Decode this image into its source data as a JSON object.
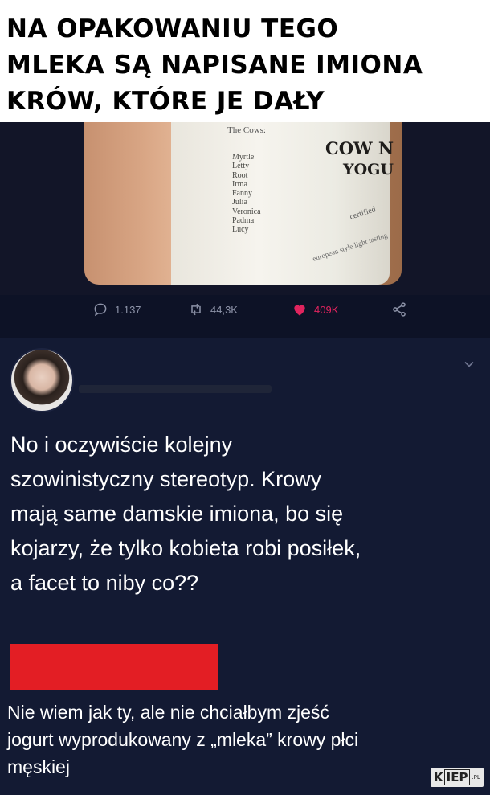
{
  "caption": {
    "lines": [
      "NA OPAKOWANIU TEGO",
      "MLEKA SĄ NAPISANE IMIONA",
      "KRÓW, KTÓRE JE DAŁY"
    ]
  },
  "photo": {
    "cows_heading": "The Cows:",
    "cow_names": [
      "Myrtle",
      "Letty",
      "Root",
      "Irma",
      "Fanny",
      "Julia",
      "Veronica",
      "Padma",
      "Lucy"
    ],
    "brand_line1": "COW N",
    "brand_line2": "YOGU",
    "small_text1": "certified",
    "small_text2": "european style light tasting"
  },
  "tweet_actions": {
    "replies": "1.137",
    "retweets": "44,3K",
    "likes": "409K"
  },
  "comment": {
    "text": "No i oczywiście kolejny\nszowinistyczny stereotyp. Krowy\nmają same damskie imiona, bo się\nkojarzy, że tylko kobieta robi posiłek,\na facet to niby co??"
  },
  "reply": {
    "text": "Nie wiem jak ty, ale nie chciałbym zjeść\njogurt wyprodukowany z „mleka” krowy płci\nmęskiej"
  },
  "watermark": {
    "left": "K",
    "box": "IEP",
    "suffix": ".PL"
  },
  "colors": {
    "like": "#e0245e",
    "redaction": "#e31e24",
    "background": "#0d1226"
  }
}
